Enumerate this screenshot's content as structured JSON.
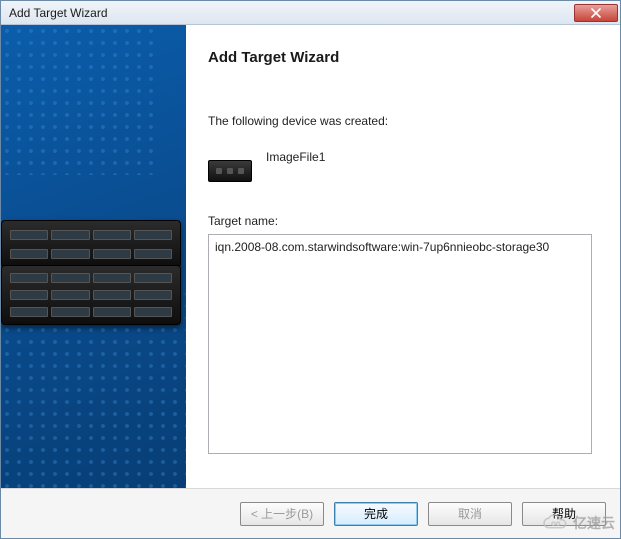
{
  "window": {
    "title": "Add Target Wizard"
  },
  "wizard": {
    "heading": "Add Target Wizard",
    "created_text": "The following device was created:",
    "device_name": "ImageFile1",
    "target_name_label": "Target name:",
    "target_name_value": "iqn.2008-08.com.starwindsoftware:win-7up6nnieobc-storage30"
  },
  "buttons": {
    "back": "< 上一步(B)",
    "finish": "完成",
    "cancel": "取消",
    "help": "帮助"
  },
  "watermark": {
    "text": "亿速云"
  }
}
